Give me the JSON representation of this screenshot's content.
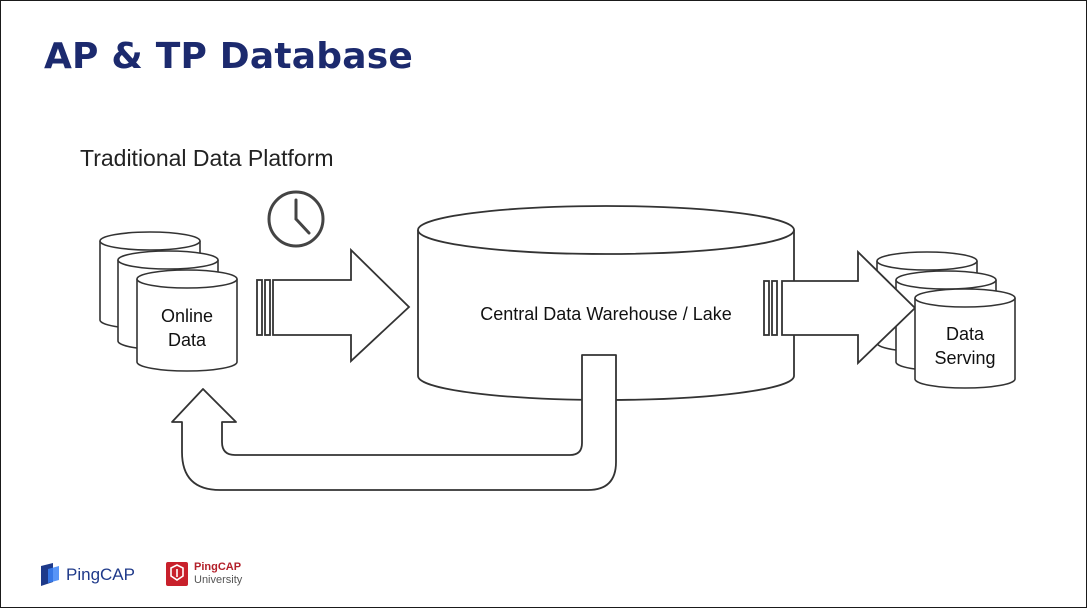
{
  "slide": {
    "title": "AP & TP Database"
  },
  "diagram": {
    "subtitle": "Traditional Data Platform",
    "online_data": [
      "Online",
      "Data"
    ],
    "warehouse": "Central Data Warehouse / Lake",
    "data_serving": [
      "Data",
      "Serving"
    ]
  },
  "footer": {
    "brand": "PingCAP",
    "university_name": "PingCAP",
    "university_sub": "University"
  }
}
